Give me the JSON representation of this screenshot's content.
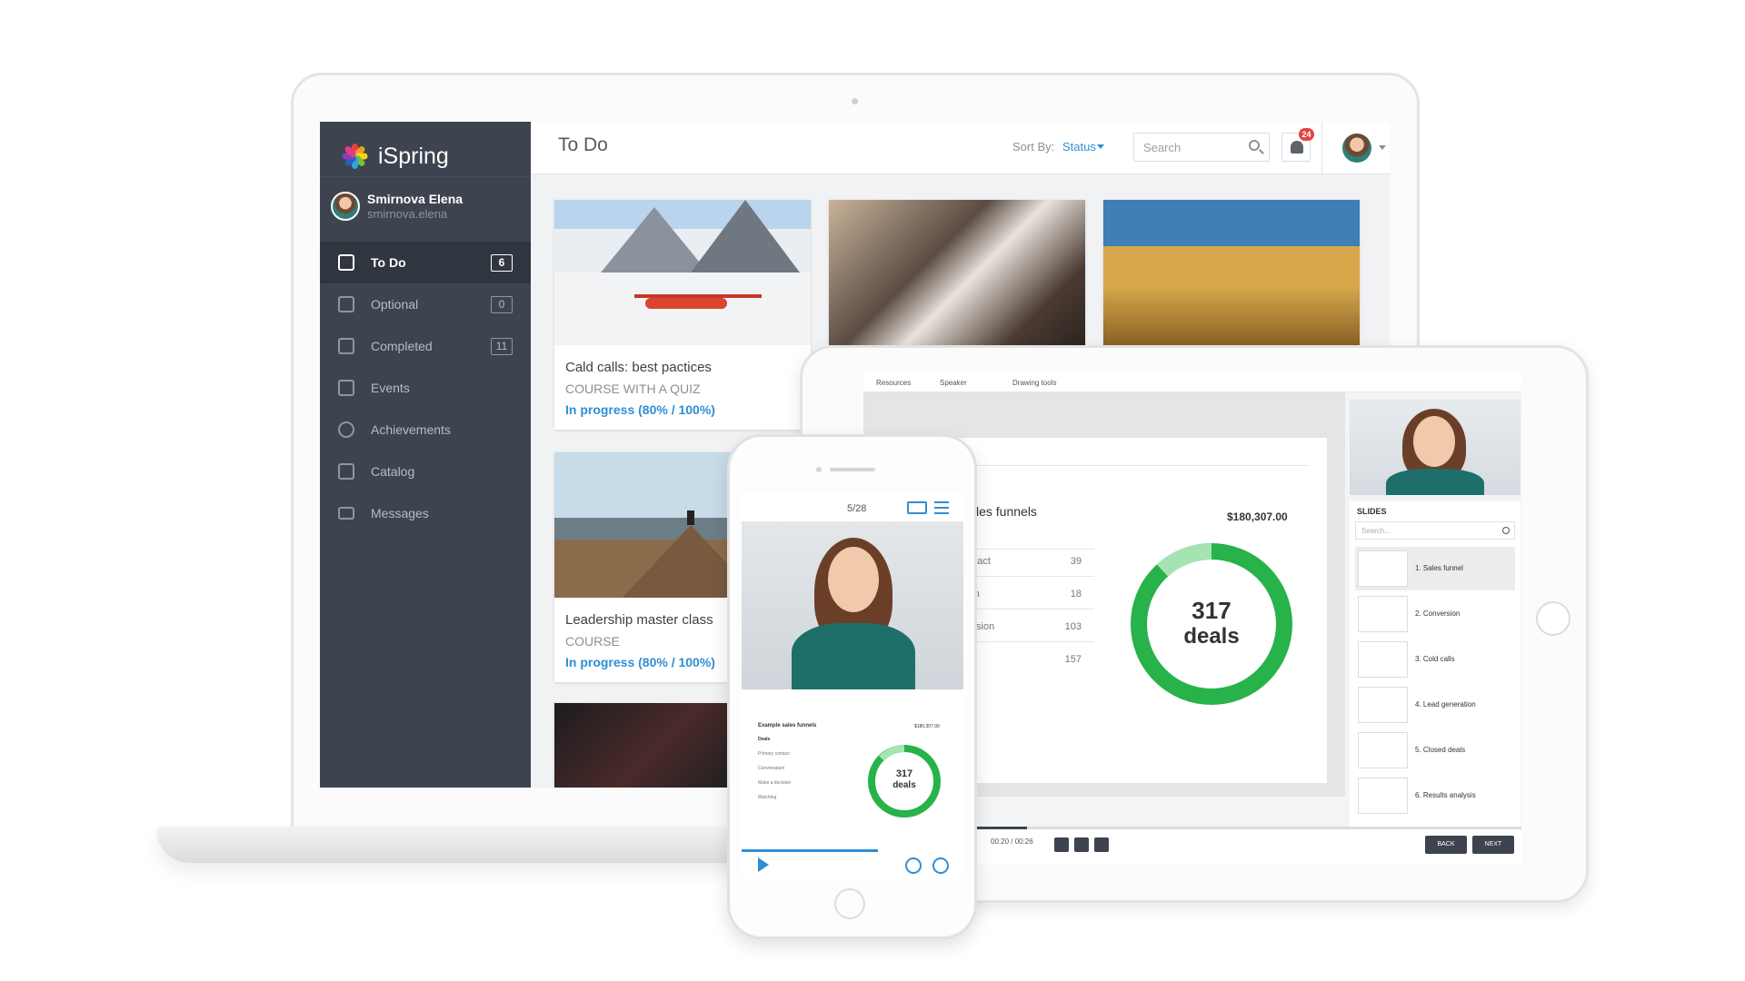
{
  "brand": {
    "name": "iSpring",
    "accent": "#2f8fd3",
    "sidebar_bg": "#3d4450",
    "donut_green": "#27b24a"
  },
  "user": {
    "name": "Smirnova Elena",
    "login": "smirnova.elena"
  },
  "sidebar": {
    "items": [
      {
        "label": "To Do",
        "count": "6",
        "icon": "todo-icon",
        "active": true
      },
      {
        "label": "Optional",
        "count": "0",
        "icon": "optional-icon"
      },
      {
        "label": "Completed",
        "count": "11",
        "icon": "completed-icon"
      },
      {
        "label": "Events",
        "icon": "calendar-icon"
      },
      {
        "label": "Achievements",
        "icon": "achievements-icon"
      },
      {
        "label": "Catalog",
        "icon": "catalog-icon"
      },
      {
        "label": "Messages",
        "icon": "envelope-icon"
      }
    ]
  },
  "header": {
    "title": "To Do",
    "sort_label": "Sort By:",
    "sort_value": "Status",
    "search_placeholder": "Search",
    "notification_count": "24"
  },
  "cards": [
    {
      "title": "Cald calls: best pactices",
      "type": "COURSE WITH A QUIZ",
      "status": "In progress (80% / 100%)"
    },
    {
      "title": "Leadership master class",
      "type": "COURSE",
      "status": "In progress (80% / 100%)"
    }
  ],
  "tablet": {
    "tabs": [
      "Resources",
      "Speaker",
      "Drawing tools"
    ],
    "slide": {
      "title": "les funnels",
      "amount": "$180,307.00",
      "rows": [
        {
          "label": "ontact",
          "value": "39"
        },
        {
          "label": "tion",
          "value": "18"
        },
        {
          "label": "ecision",
          "value": "103"
        },
        {
          "label": "",
          "value": "157"
        }
      ],
      "donut_number": "317",
      "donut_label": "deals"
    },
    "slides_heading": "SLIDES",
    "slides_search_placeholder": "Search...",
    "slides": [
      "1. Sales funnel",
      "2. Conversion",
      "3. Cold calls",
      "4. Lead generation",
      "5. Closed deals",
      "6. Results analysis"
    ],
    "time": "00:20 / 00:26",
    "back_label": "BACK",
    "next_label": "NEXT"
  },
  "phone": {
    "page_counter": "5/28",
    "slide_title": "Example sales funnels",
    "slide_amount": "$180,307.00",
    "slide_subtitle": "Deals",
    "rows": [
      "Primary contact",
      "Conversation",
      "Make a decision",
      "Matching"
    ],
    "donut_number": "317",
    "donut_label": "deals"
  }
}
